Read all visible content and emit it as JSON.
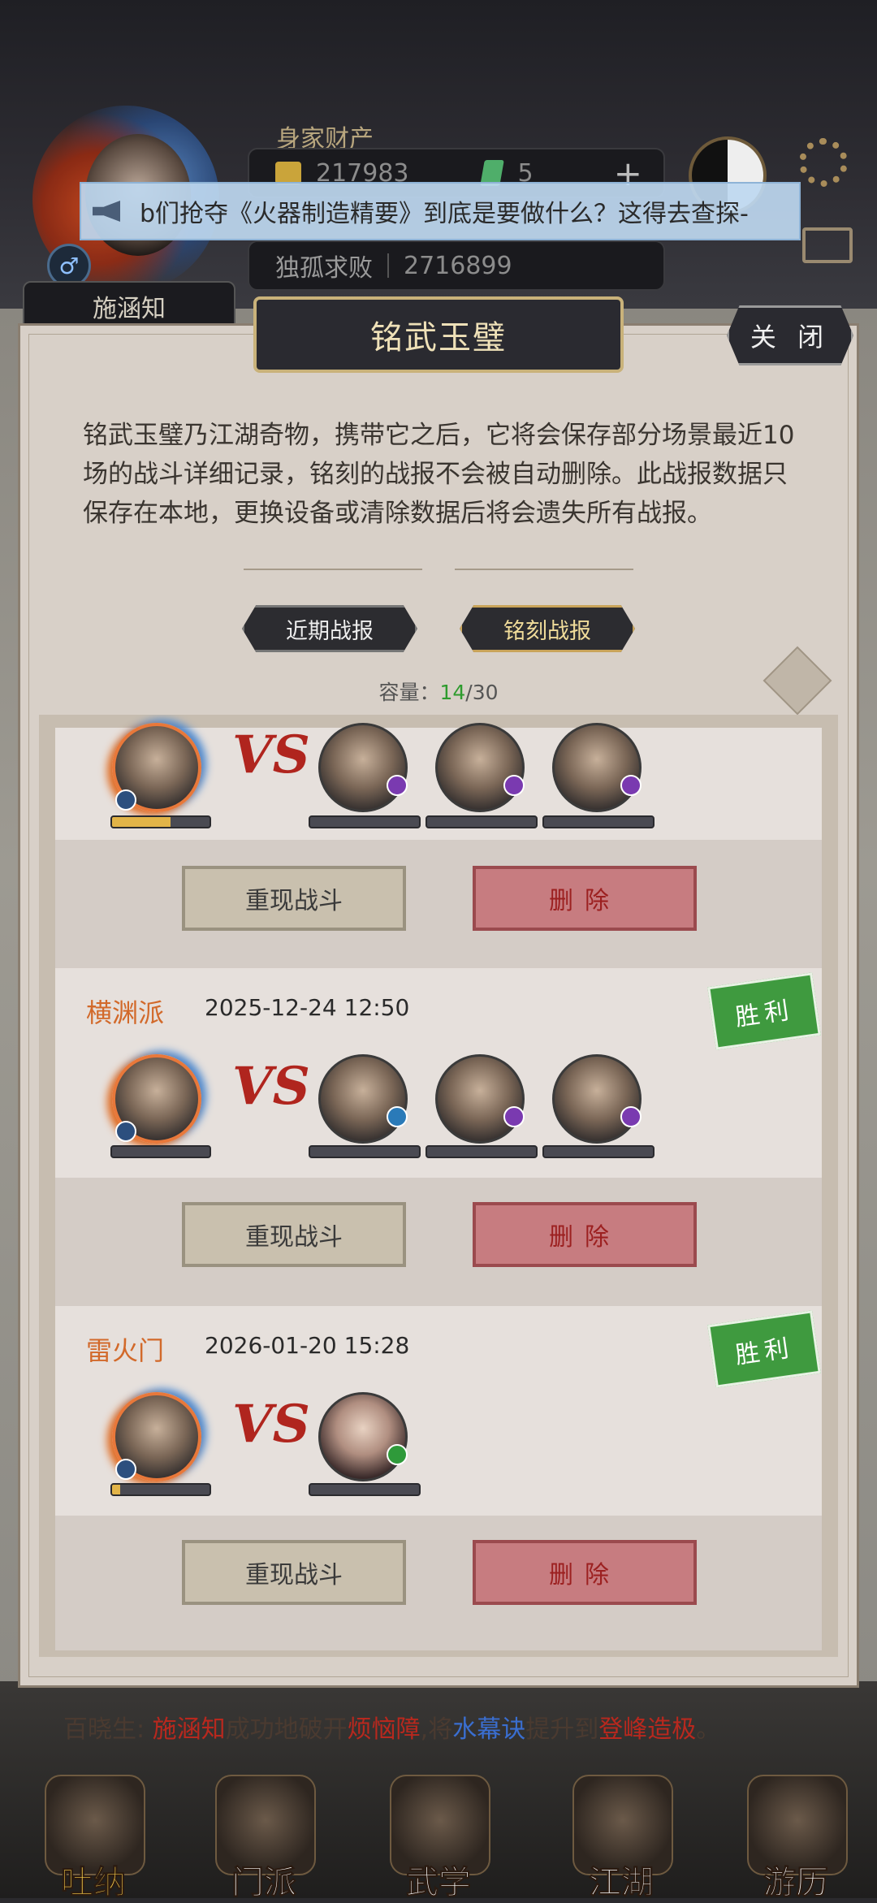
{
  "header": {
    "player_name": "施涵知",
    "gender_symbol": "♂",
    "wealth_label": "身家财产",
    "gold": "217983",
    "jade": "5",
    "rank_title": "独孤求败",
    "rank_score": "2716899"
  },
  "marquee": {
    "text": "b们抢夺《火器制造精要》到底是要做什么？这得去查探-"
  },
  "panel": {
    "title": "铭武玉璧",
    "close_label": "关 闭",
    "description": "铭武玉璧乃江湖奇物，携带它之后，它将会保存部分场景最近10场的战斗详细记录，铭刻的战报不会被自动删除。此战报数据只保存在本地，更换设备或清除数据后将会遗失所有战报。",
    "tabs": [
      {
        "label": "近期战报",
        "active": false
      },
      {
        "label": "铭刻战报",
        "active": true
      }
    ],
    "capacity_label": "容量：",
    "capacity_current": "14",
    "capacity_total": "/30"
  },
  "battles": [
    {
      "sect": "",
      "date": "",
      "result": "",
      "player_hp": 0.6,
      "vs_label": "VS",
      "opponents": 3,
      "replay_label": "重现战斗",
      "delete_label": "删除"
    },
    {
      "sect": "横渊派",
      "date": "2025-12-24 12:50",
      "result": "胜利",
      "player_hp": 0,
      "vs_label": "VS",
      "opponents": 3,
      "replay_label": "重现战斗",
      "delete_label": "删除"
    },
    {
      "sect": "雷火门",
      "date": "2026-01-20 15:28",
      "result": "胜利",
      "player_hp": 0.08,
      "vs_label": "VS",
      "opponents": 1,
      "replay_label": "重现战斗",
      "delete_label": "删除"
    }
  ],
  "news": {
    "speaker": "百晓生:",
    "player": "施涵知",
    "mid1": "成功地破开",
    "obstacle": "烦恼障",
    "mid2": ",将",
    "skill": "水幕诀",
    "mid3": "提升到",
    "level": "登峰造极",
    "end": "。"
  },
  "nav": [
    {
      "label": "吐纳",
      "active": true
    },
    {
      "label": "门派",
      "active": false
    },
    {
      "label": "武学",
      "active": false
    },
    {
      "label": "江湖",
      "active": false
    },
    {
      "label": "游历",
      "active": false
    }
  ],
  "colors": {
    "win_green": "#3f9a3f",
    "sect_orange": "#d2692a",
    "delete_red": "#c77c80",
    "capacity_green": "#2e9b2e"
  }
}
